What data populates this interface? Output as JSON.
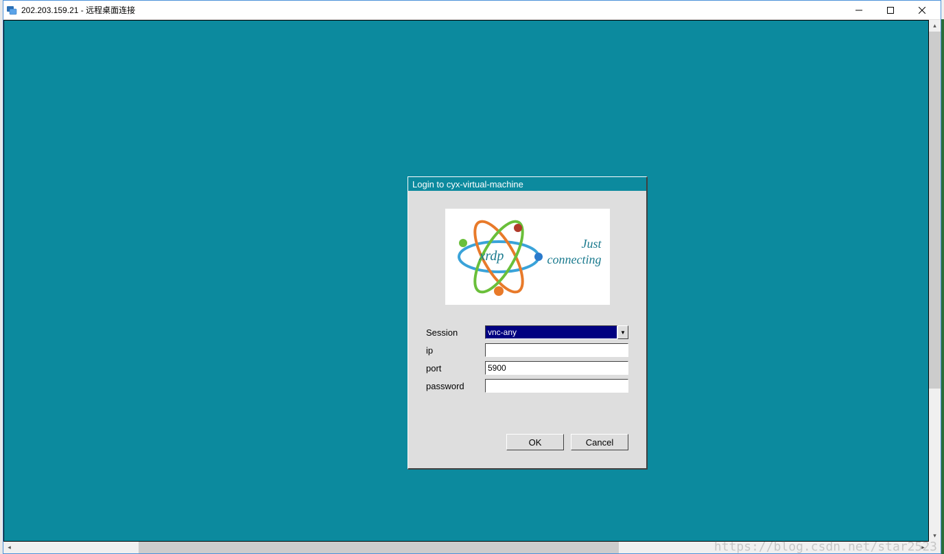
{
  "window": {
    "title": "202.203.159.21 - 远程桌面连接"
  },
  "dialog": {
    "title": "Login to cyx-virtual-machine",
    "logo_name": "xrdp",
    "slogan_line1": "Just",
    "slogan_line2": "connecting",
    "session_label": "Session",
    "session_value": "vnc-any",
    "ip_label": "ip",
    "ip_value": "",
    "port_label": "port",
    "port_value": "5900",
    "password_label": "password",
    "password_value": "",
    "ok": "OK",
    "cancel": "Cancel"
  },
  "watermark": "https://blog.csdn.net/star2523"
}
